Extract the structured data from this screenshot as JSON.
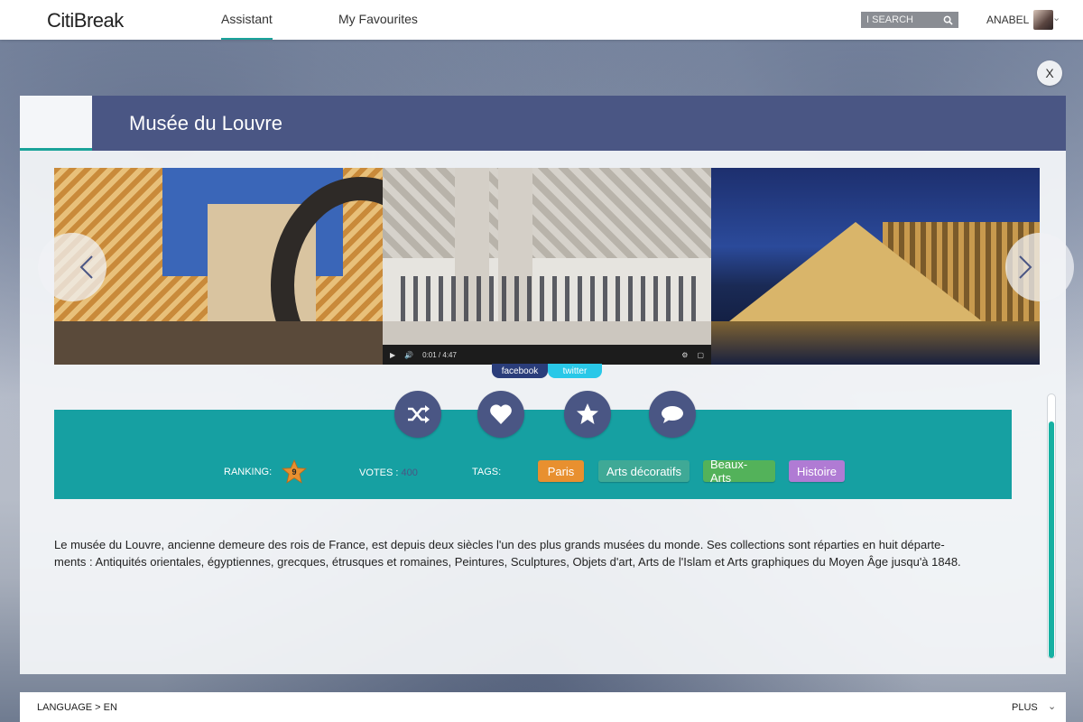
{
  "app": {
    "logo": "CitiBreak"
  },
  "nav": {
    "tabs": [
      {
        "label": "Assistant",
        "active": true
      },
      {
        "label": "My Favourites",
        "active": false
      }
    ]
  },
  "search": {
    "placeholder": "I SEARCH",
    "icon": "search-icon"
  },
  "user": {
    "name": "ANABEL"
  },
  "close_label": "X",
  "place": {
    "title": "Musée du Louvre"
  },
  "gallery": {
    "video": {
      "time": "0:01 / 4:47"
    }
  },
  "social": {
    "facebook": "facebook",
    "twitter": "twitter"
  },
  "actions": [
    {
      "icon": "shuffle-icon"
    },
    {
      "icon": "heart-icon"
    },
    {
      "icon": "star-icon"
    },
    {
      "icon": "comment-icon"
    }
  ],
  "info": {
    "ranking_label": "RANKING:",
    "ranking_value": "9",
    "votes_label": "VOTES :",
    "votes_value": "400",
    "tags_label": "TAGS:"
  },
  "tags": [
    {
      "label": "Paris",
      "color": "#e8902f"
    },
    {
      "label": "Arts décoratifs",
      "color": "#3fa996"
    },
    {
      "label": "Beaux-Arts",
      "color": "#53b25a"
    },
    {
      "label": "Histoire",
      "color": "#b07bd4"
    }
  ],
  "description": {
    "line1": "Le musée du Louvre, ancienne demeure des rois de France, est depuis deux siècles l'un des plus grands musées du monde. Ses collections sont réparties en huit départe-",
    "line2": "ments : Antiquités orientales, égyptiennes, grecques, étrusques et romaines, Peintures, Sculptures, Objets d'art, Arts de l'Islam et Arts graphiques du Moyen Âge jusqu'à 1848."
  },
  "footer": {
    "language": "LANGUAGE > EN",
    "more": "PLUS"
  },
  "colors": {
    "accent": "#1aa39a",
    "header": "#4a5684",
    "band": "#16a0a2"
  }
}
